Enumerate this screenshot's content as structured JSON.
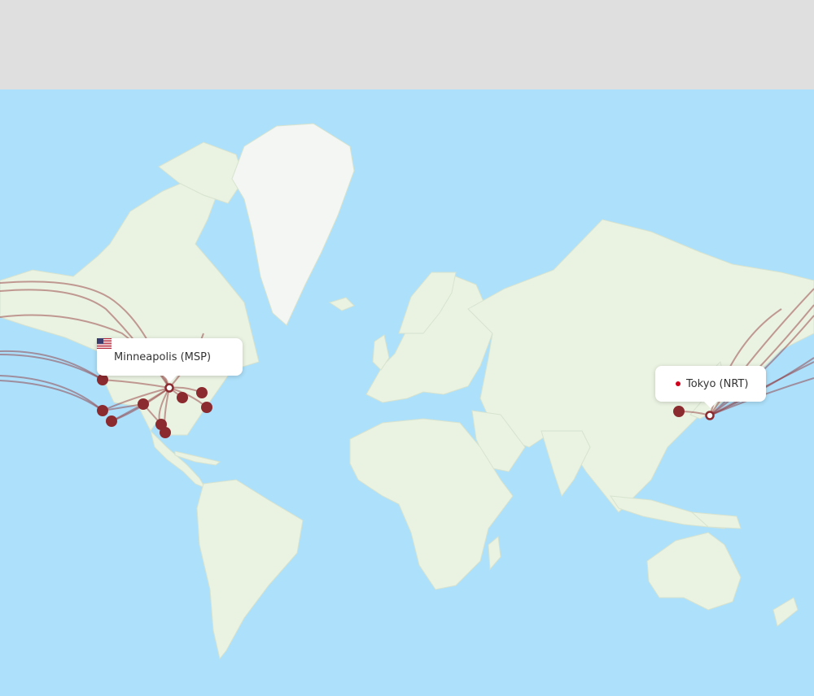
{
  "colors": {
    "ocean": "#ade0fa",
    "land": "#eaf2e2",
    "greenland": "#f3f6f2",
    "route": "#8b2a2f",
    "airport": "#8b2a2f",
    "header": "#dfdfdf"
  },
  "origin": {
    "label": "Minneapolis (MSP)",
    "flag_icon": "us-flag-icon"
  },
  "destination": {
    "label": "Tokyo (NRT)",
    "dot_icon": "red-dot-icon"
  }
}
